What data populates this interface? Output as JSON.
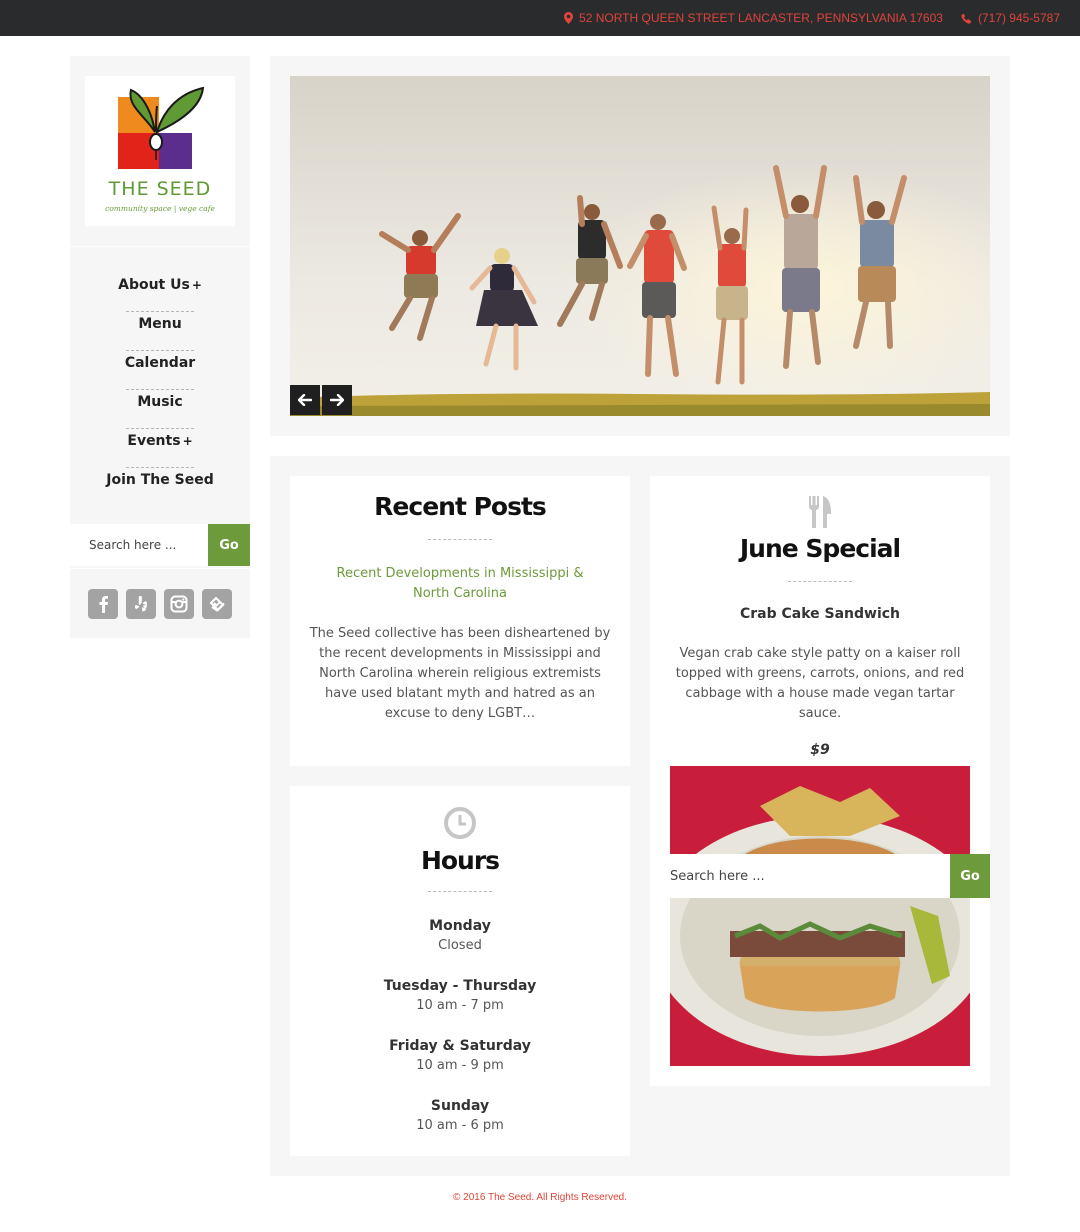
{
  "topbar": {
    "address": "52 NORTH QUEEN STREET LANCASTER, PENNSYLVANIA 17603",
    "phone": "(717) 945-5787",
    "accent": "#e0443a"
  },
  "logo": {
    "title": "THE SEED",
    "tagline": "community space | vege cafe"
  },
  "nav": [
    {
      "label": "About Us",
      "has_submenu": true,
      "plus": "+"
    },
    {
      "label": "Menu",
      "has_submenu": false
    },
    {
      "label": "Calendar",
      "has_submenu": false
    },
    {
      "label": "Music",
      "has_submenu": false
    },
    {
      "label": "Events",
      "has_submenu": true,
      "plus": "+"
    },
    {
      "label": "Join The Seed",
      "has_submenu": false
    }
  ],
  "sidebar_search": {
    "placeholder": "Search here ...",
    "button_label": "Go"
  },
  "social_icons": [
    "facebook-icon",
    "yelp-icon",
    "instagram-icon",
    "foursquare-icon"
  ],
  "slider": {
    "prev_icon": "arrow-left-icon",
    "next_icon": "arrow-right-icon"
  },
  "recent_posts": {
    "title": "Recent Posts",
    "post_link": "Recent Developments in Mississippi & North Carolina",
    "excerpt": "The Seed collective has been disheartened by the recent developments in Mississippi and North Carolina wherein religious extremists have used blatant myth and hatred as an excuse to deny LGBT…"
  },
  "hours": {
    "title": "Hours",
    "icon": "clock-icon",
    "entries": [
      {
        "day": "Monday",
        "time": "Closed"
      },
      {
        "day": "Tuesday - Thursday",
        "time": "10 am - 7 pm"
      },
      {
        "day": "Friday & Saturday",
        "time": "10 am - 9 pm"
      },
      {
        "day": "Sunday",
        "time": "10 am - 6 pm"
      }
    ]
  },
  "special": {
    "icon": "fork-knife-icon",
    "title": "June Special",
    "item": "Crab Cake Sandwich",
    "description": "Vegan crab cake style patty on a kaiser roll topped with greens, carrots, onions, and red cabbage with a house made vegan tartar sauce.",
    "price": "$9"
  },
  "floating_search": {
    "placeholder": "Search here ...",
    "button_label": "Go"
  },
  "colors": {
    "brand_green": "#6d9a3a",
    "panel_bg": "#f6f6f6",
    "topbar_bg": "#2a2b2d"
  },
  "footer": {
    "copyright": "© 2016 The Seed. All Rights Reserved."
  }
}
